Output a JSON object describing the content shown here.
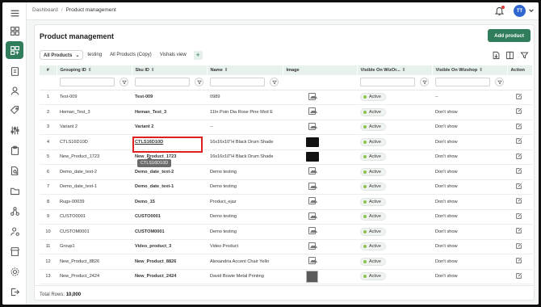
{
  "breadcrumb": {
    "root": "Dashboard",
    "current": "Product management"
  },
  "user": {
    "initials": "TT"
  },
  "page": {
    "title": "Product management",
    "add_button": "Add product"
  },
  "views": {
    "tabs": [
      "All Products",
      "testing",
      "All Products (Copy)",
      "Vishals view"
    ],
    "active": "All Products"
  },
  "table": {
    "columns": [
      "#",
      "Grouping ID",
      "Sku ID",
      "Name",
      "Image",
      "Visible On WizOr...",
      "Visible On Wizshop",
      "Action"
    ],
    "rows": [
      {
        "n": "1",
        "group": "Test-009",
        "sku": "Test-009",
        "name": "0989",
        "image": "placeholder",
        "status": "Active",
        "shop": "--"
      },
      {
        "n": "2",
        "group": "Heman_Test_3",
        "sku": "Heman_Test_3",
        "name": "11In Poin Dia Rose Pine Mxd E",
        "image": "placeholder",
        "status": "Active",
        "shop": "Don't show"
      },
      {
        "n": "3",
        "group": "Variant 2",
        "sku": "Variant 2",
        "name": "--",
        "image": "placeholder",
        "status": "Active",
        "shop": "Don't show"
      },
      {
        "n": "4",
        "group": "CTLS16D10D",
        "sku": "CTLS16D10D",
        "name": "16x16x10\"H Black Drum Shade",
        "image": "dark",
        "status": "Active",
        "shop": "Don't show"
      },
      {
        "n": "5",
        "group": "New_Product_1723",
        "sku": "New_Product_1723",
        "name": "16x16x10\"H Black Drum Shade",
        "image": "dark",
        "status": "Active",
        "shop": "Don't show"
      },
      {
        "n": "6",
        "group": "Demo_date_text-2",
        "sku": "Demo_date_text-2",
        "name": "Demo testing",
        "image": "placeholder",
        "status": "Active",
        "shop": "Don't show"
      },
      {
        "n": "7",
        "group": "Demo_date_text-1",
        "sku": "Demo_date_text-1",
        "name": "Demo testing",
        "image": "placeholder",
        "status": "Active",
        "shop": "Don't show"
      },
      {
        "n": "8",
        "group": "Rugs-00039",
        "sku": "Demo_15",
        "name": "Product_ejaz",
        "image": "placeholder",
        "status": "Active",
        "shop": "Don't show"
      },
      {
        "n": "9",
        "group": "CUSTO0001",
        "sku": "CUSTO0001",
        "name": "Demo testing",
        "image": "placeholder",
        "status": "Active",
        "shop": "Don't show"
      },
      {
        "n": "10",
        "group": "CUSTOM0001",
        "sku": "CUSTOM0001",
        "name": "Demo testing",
        "image": "placeholder",
        "status": "Active",
        "shop": "Don't show"
      },
      {
        "n": "11",
        "group": "Group1",
        "sku": "Video_product_3",
        "name": "Video Product",
        "image": "placeholder",
        "status": "Active",
        "shop": "Don't show"
      },
      {
        "n": "12",
        "group": "New_Product_8826",
        "sku": "New_Product_8826",
        "name": "Alexandria Accent Chair Yello",
        "image": "placeholder",
        "status": "Active",
        "shop": "Don't show"
      },
      {
        "n": "13",
        "group": "New_Product_2424",
        "sku": "New_Product_2424",
        "name": "David Bowie Metal Printing",
        "image": "photo",
        "status": "Active",
        "shop": "Don't show"
      }
    ]
  },
  "tooltip": {
    "text": "CTLS16D10D"
  },
  "footer": {
    "label": "Total Rows:",
    "value": "10,000"
  },
  "colors": {
    "brand": "#2f7d5b",
    "header_bg": "#e8f2ed",
    "highlight": "#e02020",
    "active_dot": "#8bc34a"
  }
}
